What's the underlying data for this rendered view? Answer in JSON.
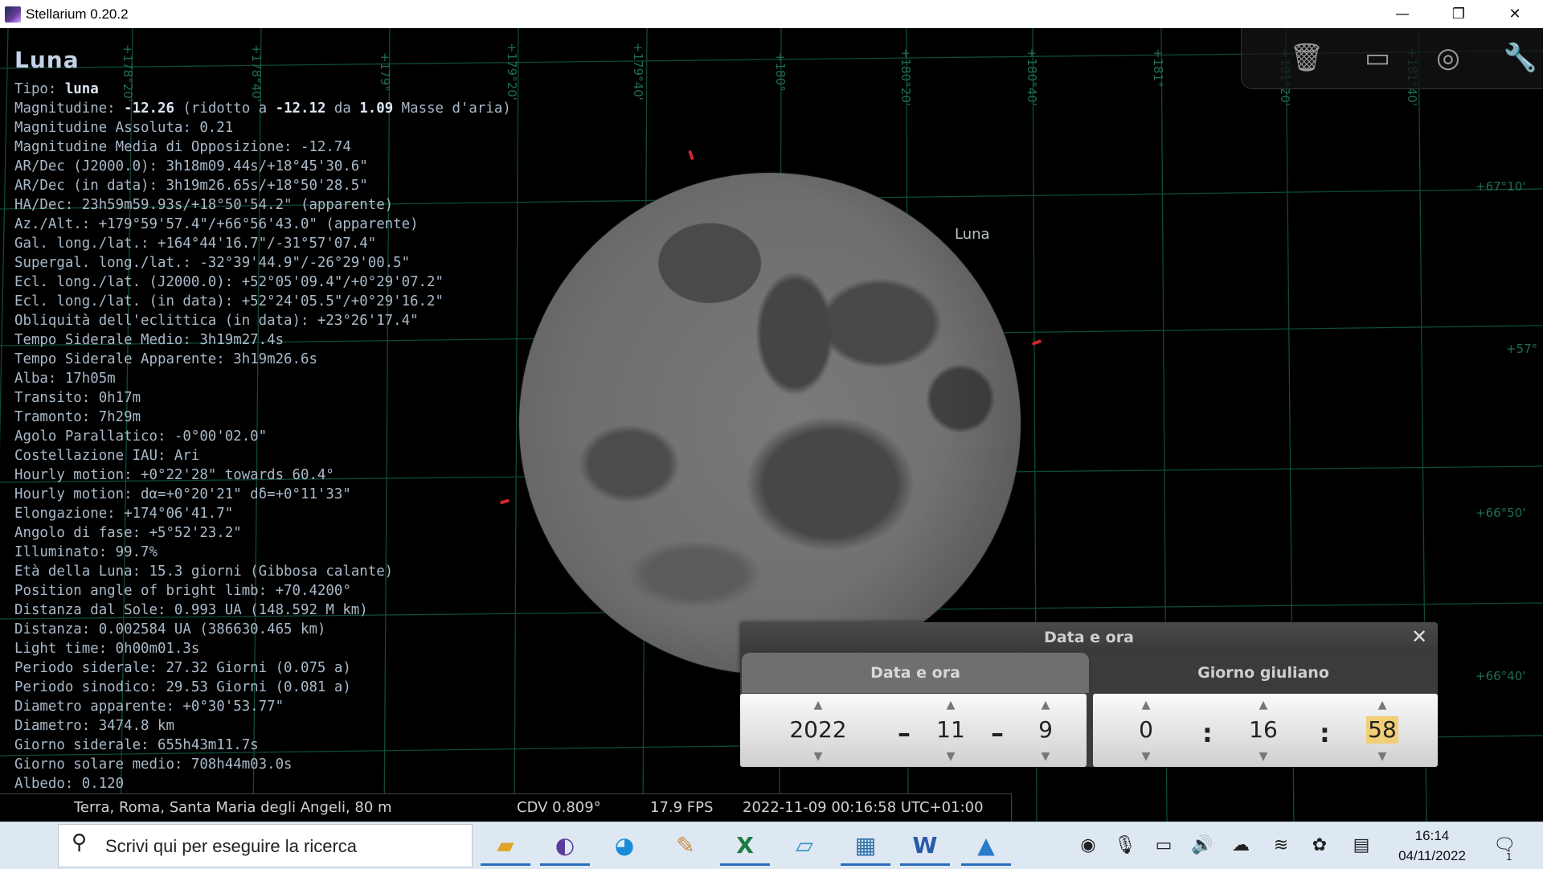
{
  "window": {
    "title": "Stellarium 0.20.2",
    "minimize": "—",
    "restore": "❐",
    "close": "✕"
  },
  "sky": {
    "object_label": "Luna",
    "grid_labels": [
      {
        "text": "+178°20'",
        "cls": "v"
      },
      {
        "text": "+178°40'",
        "cls": "v"
      },
      {
        "text": "+179°",
        "cls": "v"
      },
      {
        "text": "+179°20'",
        "cls": "v"
      },
      {
        "text": "+179°40'",
        "cls": "v"
      },
      {
        "text": "+180°",
        "cls": "v"
      },
      {
        "text": "+180°20'",
        "cls": "v"
      },
      {
        "text": "+180°40'",
        "cls": "v"
      },
      {
        "text": "+181°",
        "cls": "v"
      },
      {
        "text": "+181°20'",
        "cls": "v"
      },
      {
        "text": "+181°40'",
        "cls": "v"
      },
      {
        "text": "+67°10'",
        "cls": "h"
      },
      {
        "text": "+57°",
        "cls": "h"
      },
      {
        "text": "+66°50'",
        "cls": "h"
      },
      {
        "text": "+66°40'",
        "cls": "h"
      }
    ]
  },
  "info": {
    "title": "Luna",
    "type_label": "Tipo: ",
    "type_value": "luna",
    "mag_label": "Magnitudine: ",
    "mag_value": "-12.26",
    "mag_mid1": " (ridotto a ",
    "mag_red": "-12.12",
    "mag_mid2": " da ",
    "mag_air": "1.09",
    "mag_end": " Masse d'aria)",
    "lines": [
      "Magnitudine Assoluta: 0.21",
      "Magnitudine Media di Opposizione: -12.74",
      "AR/Dec (J2000.0): 3h18m09.44s/+18°45'30.6\"",
      "AR/Dec (in data): 3h19m26.65s/+18°50'28.5\"",
      "HA/Dec: 23h59m59.93s/+18°50'54.2\" (apparente)",
      "Az./Alt.: +179°59'57.4\"/+66°56'43.0\" (apparente)",
      "Gal. long./lat.: +164°44'16.7\"/-31°57'07.4\"",
      "Supergal. long./lat.: -32°39'44.9\"/-26°29'00.5\"",
      "Ecl. long./lat. (J2000.0): +52°05'09.4\"/+0°29'07.2\"",
      "Ecl. long./lat. (in data): +52°24'05.5\"/+0°29'16.2\"",
      "Obliquità dell'eclittica (in data): +23°26'17.4\"",
      "Tempo Siderale Medio: 3h19m27.4s",
      "Tempo Siderale Apparente: 3h19m26.6s",
      "Alba: 17h05m",
      "Transito: 0h17m",
      "Tramonto: 7h29m",
      "Agolo Parallatico: -0°00'02.0\"",
      "Costellazione IAU: Ari",
      "Hourly motion: +0°22'28\" towards 60.4°",
      "Hourly motion: dα=+0°20'21\" dδ=+0°11'33\"",
      "Elongazione: +174°06'41.7\"",
      "Angolo di fase: +5°52'23.2\"",
      "Illuminato: 99.7%",
      "Età della Luna: 15.3 giorni (Gibbosa calante)",
      "Position angle of bright limb: +70.4200°",
      "Distanza dal Sole: 0.993 UA (148.592 M km)",
      "Distanza: 0.002584 UA (386630.465 km)",
      "Light time: 0h00m01.3s",
      "Periodo siderale: 27.32 Giorni (0.075 a)",
      "Periodo sinodico: 29.53 Giorni (0.081 a)",
      "Diametro apparente: +0°30'53.77\"",
      "Diametro: 3474.8 km",
      "Giorno siderale: 655h43m11.7s",
      "Giorno solare medio: 708h44m03.0s",
      "Albedo: 0.120"
    ]
  },
  "status": {
    "location": "Terra, Roma, Santa Maria degli Angeli, 80 m",
    "fov": "CDV 0.809°",
    "fps": "17.9 FPS",
    "datetime": "2022-11-09 00:16:58 UTC+01:00"
  },
  "dialog": {
    "title": "Data e ora",
    "close": "✕",
    "tab_date": "Data e ora",
    "tab_julian": "Giorno giuliano",
    "year": "2022",
    "month": "11",
    "day": "9",
    "hour": "0",
    "minute": "16",
    "second": "58",
    "date_sep": "–",
    "time_sep": ":",
    "up": "▲",
    "down": "▼"
  },
  "taskbar": {
    "search_placeholder": "Scrivi qui per eseguire la ricerca",
    "clock_time": "16:14",
    "clock_date": "04/11/2022",
    "notifications_count": "1"
  }
}
